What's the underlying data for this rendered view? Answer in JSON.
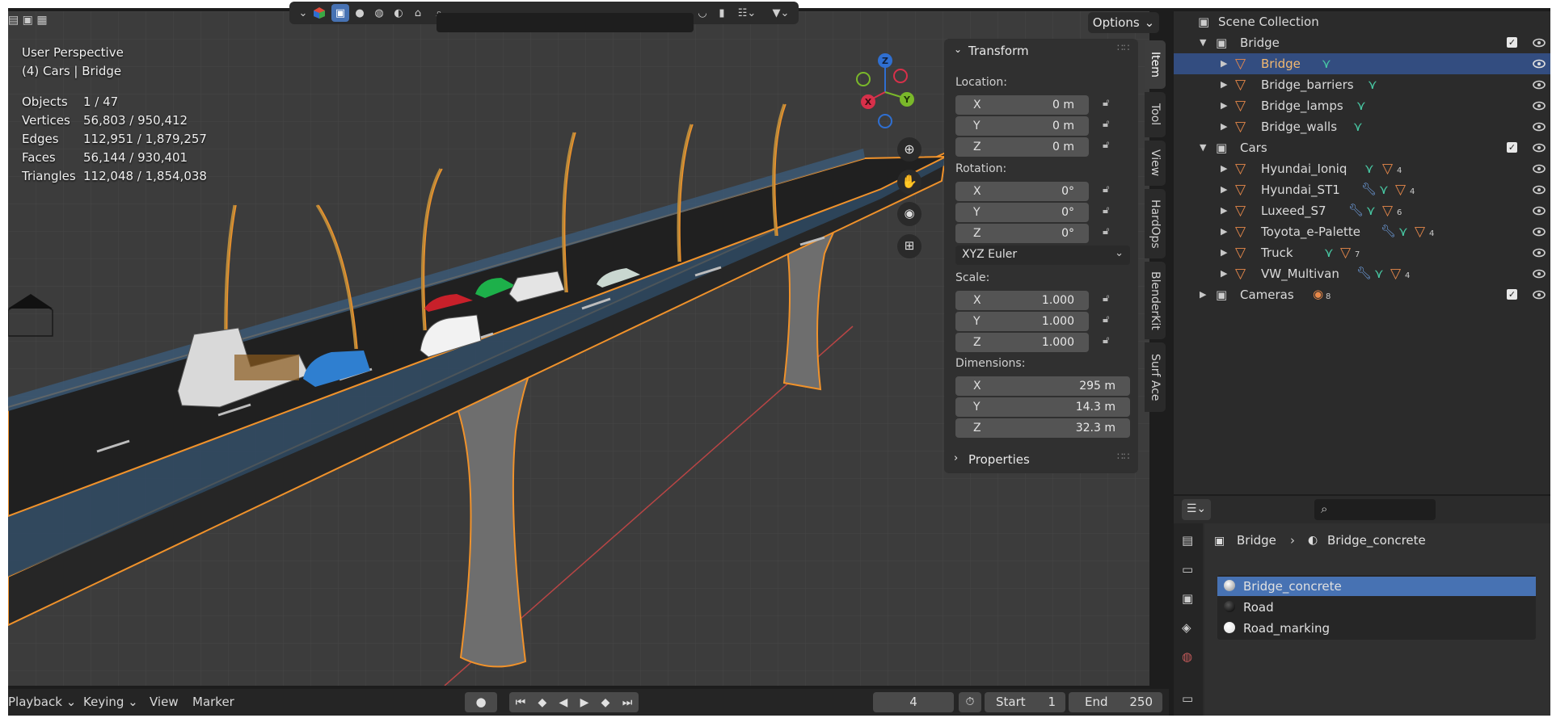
{
  "viewport": {
    "perspective": "User Perspective",
    "context": "(4) Cars | Bridge",
    "stats": [
      {
        "label": "Objects",
        "value": "1 / 47"
      },
      {
        "label": "Vertices",
        "value": "56,803 / 950,412"
      },
      {
        "label": "Edges",
        "value": "112,951 / 1,879,257"
      },
      {
        "label": "Faces",
        "value": "56,144 / 930,401"
      },
      {
        "label": "Triangles",
        "value": "112,048 / 1,854,038"
      }
    ],
    "options_label": "Options",
    "gizmo": {
      "x": "X",
      "y": "Y",
      "z": "Z"
    }
  },
  "npanel": {
    "transform_title": "Transform",
    "location_label": "Location:",
    "location": [
      {
        "axis": "X",
        "value": "0 m"
      },
      {
        "axis": "Y",
        "value": "0 m"
      },
      {
        "axis": "Z",
        "value": "0 m"
      }
    ],
    "rotation_label": "Rotation:",
    "rotation": [
      {
        "axis": "X",
        "value": "0°"
      },
      {
        "axis": "Y",
        "value": "0°"
      },
      {
        "axis": "Z",
        "value": "0°"
      }
    ],
    "rotation_mode": "XYZ Euler",
    "scale_label": "Scale:",
    "scale": [
      {
        "axis": "X",
        "value": "1.000"
      },
      {
        "axis": "Y",
        "value": "1.000"
      },
      {
        "axis": "Z",
        "value": "1.000"
      }
    ],
    "dimensions_label": "Dimensions:",
    "dimensions": [
      {
        "axis": "X",
        "value": "295 m"
      },
      {
        "axis": "Y",
        "value": "14.3 m"
      },
      {
        "axis": "Z",
        "value": "32.3 m"
      }
    ],
    "properties_title": "Properties",
    "tabs": [
      "Item",
      "Tool",
      "View",
      "HardOps",
      "BlenderKit",
      "Surf Ace"
    ]
  },
  "timeline": {
    "playback": "Playback",
    "keying": "Keying",
    "view": "View",
    "marker": "Marker",
    "current_frame": "4",
    "start_label": "Start",
    "start_value": "1",
    "end_label": "End",
    "end_value": "250"
  },
  "outliner": {
    "root": "Scene Collection",
    "rows": [
      {
        "name": "Bridge",
        "kind": "collection"
      },
      {
        "name": "Bridge",
        "kind": "object",
        "selected": true
      },
      {
        "name": "Bridge_barriers",
        "kind": "object"
      },
      {
        "name": "Bridge_lamps",
        "kind": "object"
      },
      {
        "name": "Bridge_walls",
        "kind": "object"
      },
      {
        "name": "Cars",
        "kind": "collection"
      },
      {
        "name": "Hyundai_Ioniq",
        "kind": "object",
        "sub": "4"
      },
      {
        "name": "Hyundai_ST1",
        "kind": "object",
        "sub": "4"
      },
      {
        "name": "Luxeed_S7",
        "kind": "object",
        "sub": "6"
      },
      {
        "name": "Toyota_e-Palette",
        "kind": "object",
        "sub": "4"
      },
      {
        "name": "Truck",
        "kind": "object",
        "sub": "7"
      },
      {
        "name": "VW_Multivan",
        "kind": "object",
        "sub": "4"
      },
      {
        "name": "Cameras",
        "kind": "collection",
        "sub": "8"
      }
    ]
  },
  "properties": {
    "breadcrumb_object": "Bridge",
    "breadcrumb_material": "Bridge_concrete",
    "materials": [
      "Bridge_concrete",
      "Road",
      "Road_marking"
    ]
  },
  "colors": {
    "selection_blue": "#4772b3",
    "outline_orange": "#f0922b",
    "object_icon": "#e8894a",
    "mesh_icon": "#48c9a4"
  }
}
